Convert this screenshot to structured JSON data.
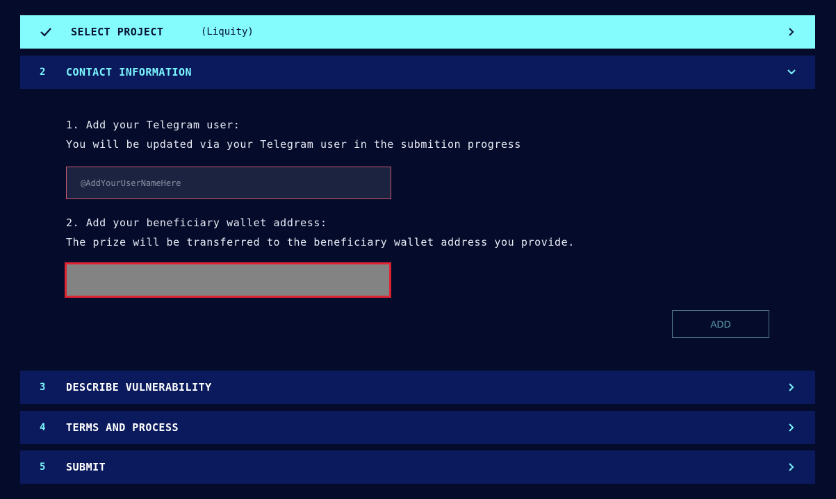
{
  "steps": {
    "select_project": {
      "label": "SELECT PROJECT",
      "project": "(Liquity)"
    },
    "contact": {
      "number": "2",
      "label": "CONTACT INFORMATION"
    },
    "describe": {
      "number": "3",
      "label": "DESCRIBE VULNERABILITY"
    },
    "terms": {
      "number": "4",
      "label": "TERMS AND PROCESS"
    },
    "submit": {
      "number": "5",
      "label": "SUBMIT"
    }
  },
  "contact_form": {
    "telegram_title": "1. Add your Telegram user:",
    "telegram_desc": "You will be updated via your Telegram user in the submition progress",
    "telegram_placeholder": "@AddYourUserNameHere",
    "wallet_title": "2. Add your beneficiary wallet address:",
    "wallet_desc": "The prize will be transferred to the beneficiary wallet address you provide.",
    "add_label": "ADD"
  },
  "colors": {
    "background": "#050b2a",
    "row_dark": "#0a1a5c",
    "row_done": "#84fbfd",
    "accent": "#7cf6ff",
    "error_border": "#e02432"
  }
}
